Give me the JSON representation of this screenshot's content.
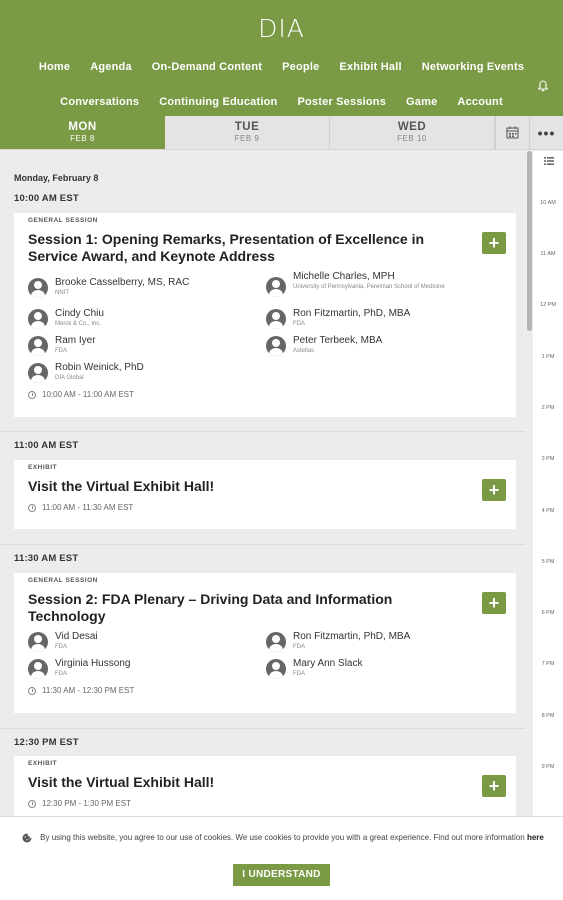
{
  "header": {
    "logo": "DIA",
    "nav_row1": [
      "Home",
      "Agenda",
      "On-Demand Content",
      "People",
      "Exhibit Hall",
      "Networking Events"
    ],
    "nav_row2": [
      "Conversations",
      "Continuing Education",
      "Poster Sessions",
      "Game",
      "Account"
    ]
  },
  "days": [
    {
      "name": "MON",
      "date": "FEB 8"
    },
    {
      "name": "TUE",
      "date": "FEB 9"
    },
    {
      "name": "WED",
      "date": "FEB 10"
    }
  ],
  "schedule": {
    "day_label": "Monday, February 8",
    "groups": [
      {
        "time": "10:00 AM EST",
        "category": "GENERAL SESSION",
        "title": "Session 1: Opening Remarks, Presentation of Excellence in Service Award, and Keynote Address",
        "speakers": [
          {
            "name": "Brooke Casselberry, MS, RAC",
            "org": "NNIT"
          },
          {
            "name": "Michelle Charles, MPH",
            "org": "University of Pennsylvania, Perelman School of Medicine"
          },
          {
            "name": "Cindy Chiu",
            "org": "Merck & Co., Inc."
          },
          {
            "name": "Ron Fitzmartin, PhD, MBA",
            "org": "FDA"
          },
          {
            "name": "Ram Iyer",
            "org": "FDA"
          },
          {
            "name": "Peter Terbeek, MBA",
            "org": "Astellas"
          },
          {
            "name": "Robin Weinick, PhD",
            "org": "DIA Global"
          }
        ],
        "session_time": "10:00 AM - 11:00 AM EST"
      },
      {
        "time": "11:00 AM EST",
        "category": "EXHIBIT",
        "title": "Visit the Virtual Exhibit Hall!",
        "speakers": [],
        "session_time": "11:00 AM - 11:30 AM EST"
      },
      {
        "time": "11:30 AM EST",
        "category": "GENERAL SESSION",
        "title": "Session 2: FDA Plenary – Driving Data and Information Technology",
        "speakers": [
          {
            "name": "Vid Desai",
            "org": "FDA"
          },
          {
            "name": "Ron Fitzmartin, PhD, MBA",
            "org": "FDA"
          },
          {
            "name": "Virginia Hussong",
            "org": "FDA"
          },
          {
            "name": "Mary Ann Slack",
            "org": "FDA"
          }
        ],
        "session_time": "11:30 AM - 12:30 PM EST"
      },
      {
        "time": "12:30 PM EST",
        "category": "EXHIBIT",
        "title": "Visit the Virtual Exhibit Hall!",
        "speakers": [],
        "session_time": "12:30 PM - 1:30 PM EST"
      }
    ]
  },
  "rail_times": [
    "10 AM",
    "11 AM",
    "12 PM",
    "1 PM",
    "2 PM",
    "3 PM",
    "4 PM",
    "5 PM",
    "6 PM",
    "7 PM",
    "8 PM",
    "9 PM"
  ],
  "cookie": {
    "text": "By using this website, you agree to our use of cookies. We use cookies to provide you with a great experience. Find out more information",
    "link": "here",
    "button": "I UNDERSTAND"
  },
  "add_label": "+",
  "colors": {
    "accent": "#7a9a45"
  }
}
